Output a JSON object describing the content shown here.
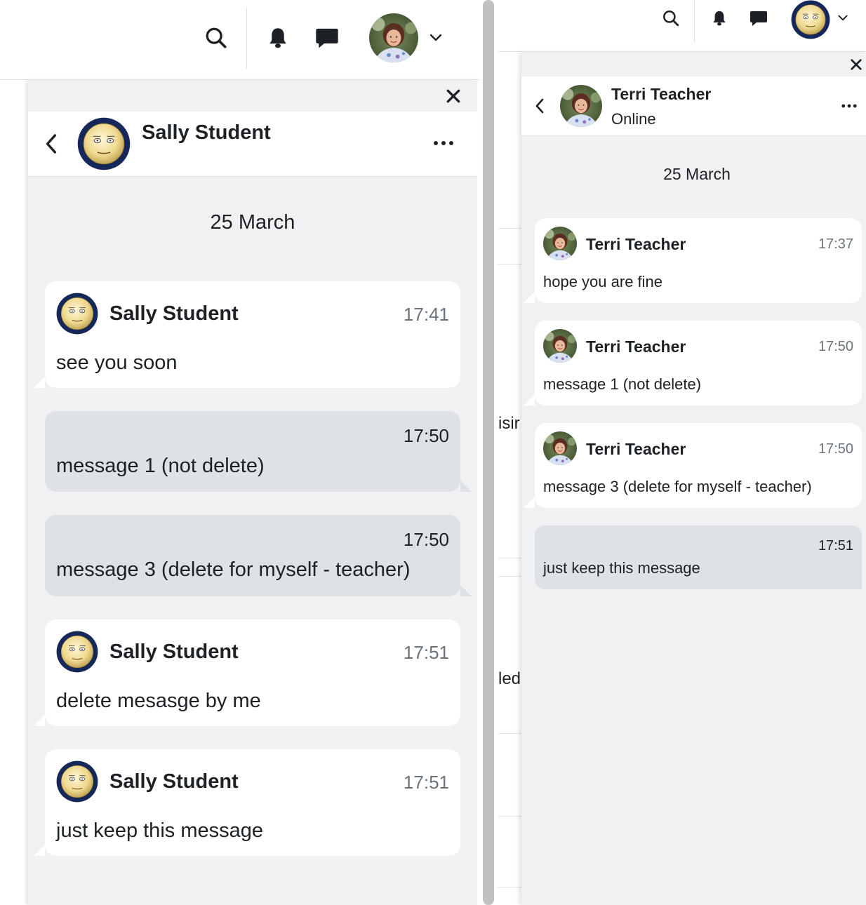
{
  "left": {
    "drawer": {
      "contact_name": "Sally Student",
      "date": "25 March",
      "messages": [
        {
          "sender": "Sally Student",
          "time": "17:41",
          "text": "see you soon"
        },
        {
          "time": "17:50",
          "text": "message 1 (not delete)"
        },
        {
          "time": "17:50",
          "text": "message 3 (delete for myself - teacher)"
        },
        {
          "sender": "Sally Student",
          "time": "17:51",
          "text": "delete mesasge by me"
        },
        {
          "sender": "Sally Student",
          "time": "17:51",
          "text": "just keep this message"
        }
      ]
    }
  },
  "right": {
    "background_fragments": [
      "isir",
      "led"
    ],
    "drawer": {
      "contact_name": "Terri Teacher",
      "contact_status": "Online",
      "date": "25 March",
      "messages": [
        {
          "sender": "Terri Teacher",
          "time": "17:37",
          "text": "hope you are fine"
        },
        {
          "sender": "Terri Teacher",
          "time": "17:50",
          "text": "message 1 (not delete)"
        },
        {
          "sender": "Terri Teacher",
          "time": "17:50",
          "text": "message 3 (delete for myself - teacher)"
        },
        {
          "time": "17:51",
          "text": "just keep this message"
        }
      ]
    }
  },
  "icons": {
    "search": "search-icon",
    "bell": "bell-icon",
    "chat": "chat-icon",
    "caret": "chevron-down-icon",
    "close": "close-icon",
    "back": "chevron-left-icon",
    "more": "more-icon"
  },
  "colors": {
    "drawer_bg": "#f0f1f3",
    "sent_bubble": "#dee1e6",
    "received_bubble": "#ffffff",
    "avatar_ring": "#1b2c5a",
    "time_gray": "#6a737b"
  }
}
